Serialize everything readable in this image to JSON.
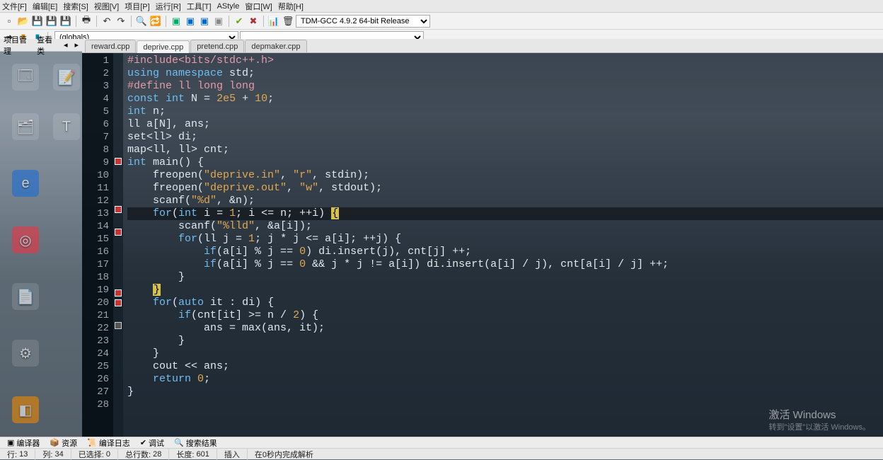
{
  "menu": {
    "items": [
      "文件[F]",
      "编辑[E]",
      "搜索[S]",
      "视图[V]",
      "项目[P]",
      "运行[R]",
      "工具[T]",
      "AStyle",
      "窗口[W]",
      "帮助[H]"
    ]
  },
  "toolbar": {
    "compiler": "TDM-GCC 4.9.2 64-bit Release",
    "scope": "(globals)"
  },
  "left": {
    "project": "项目管理",
    "view": "查看类"
  },
  "tabs": [
    {
      "label": "reward.cpp",
      "active": false
    },
    {
      "label": "deprive.cpp",
      "active": true
    },
    {
      "label": "pretend.cpp",
      "active": false
    },
    {
      "label": "depmaker.cpp",
      "active": false
    }
  ],
  "code": {
    "lines": [
      {
        "n": 1,
        "fold": "",
        "html": "<span class='pp'>#include</span><span class='pp'>&lt;bits/stdc++.h&gt;</span>"
      },
      {
        "n": 2,
        "fold": "",
        "html": "<span class='kw'>using</span> <span class='kw'>namespace</span> std;"
      },
      {
        "n": 3,
        "fold": "",
        "html": "<span class='pp'>#define ll long long</span>"
      },
      {
        "n": 4,
        "fold": "",
        "html": "<span class='kw'>const</span> <span class='type'>int</span> N = <span class='num'>2e5</span> + <span class='num'>10</span>;"
      },
      {
        "n": 5,
        "fold": "",
        "html": "<span class='type'>int</span> n;"
      },
      {
        "n": 6,
        "fold": "",
        "html": "ll a[N], ans;"
      },
      {
        "n": 7,
        "fold": "",
        "html": "set&lt;ll&gt; di;"
      },
      {
        "n": 8,
        "fold": "",
        "html": "map&lt;ll, ll&gt; cnt;"
      },
      {
        "n": 9,
        "fold": "minus",
        "html": "<span class='type'>int</span> <span class='fn'>main</span>() {"
      },
      {
        "n": 10,
        "fold": "",
        "html": "    freopen(<span class='str'>\"deprive.in\"</span>, <span class='str'>\"r\"</span>, stdin);"
      },
      {
        "n": 11,
        "fold": "",
        "html": "    freopen(<span class='str'>\"deprive.out\"</span>, <span class='str'>\"w\"</span>, stdout);"
      },
      {
        "n": 12,
        "fold": "",
        "html": "    scanf(<span class='str'>\"%d\"</span>, &amp;n);"
      },
      {
        "n": 13,
        "fold": "minus",
        "cur": true,
        "html": "    <span class='kw'>for</span>(<span class='type'>int</span> i = <span class='num'>1</span>; i &lt;= n; ++i) <span class='brace-hl'>{</span>"
      },
      {
        "n": 14,
        "fold": "",
        "html": "        scanf(<span class='str'>\"%lld\"</span>, &amp;a[i]);"
      },
      {
        "n": 15,
        "fold": "minus",
        "html": "        <span class='kw'>for</span>(ll j = <span class='num'>1</span>; j * j &lt;= a[i]; ++j) {"
      },
      {
        "n": 16,
        "fold": "",
        "html": "            <span class='kw'>if</span>(a[i] % j == <span class='num'>0</span>) di.insert(j), cnt[j] ++;"
      },
      {
        "n": 17,
        "fold": "",
        "html": "            <span class='kw'>if</span>(a[i] % j == <span class='num'>0</span> &amp;&amp; j * j != a[i]) di.insert(a[i] / j), cnt[a[i] / j] ++;"
      },
      {
        "n": 18,
        "fold": "",
        "html": "        }"
      },
      {
        "n": 19,
        "fold": "",
        "html": "    <span class='brace-hl'>}</span>"
      },
      {
        "n": 20,
        "fold": "minus",
        "html": "    <span class='kw'>for</span>(<span class='kw'>auto</span> it : di) {"
      },
      {
        "n": 21,
        "fold": "minus",
        "html": "        <span class='kw'>if</span>(cnt[it] &gt;= n / <span class='num'>2</span>) {"
      },
      {
        "n": 22,
        "fold": "",
        "html": "            ans = max(ans, it);"
      },
      {
        "n": 23,
        "fold": "box",
        "html": "        }"
      },
      {
        "n": 24,
        "fold": "",
        "html": "    }"
      },
      {
        "n": 25,
        "fold": "",
        "html": "    cout &lt;&lt; ans;"
      },
      {
        "n": 26,
        "fold": "",
        "html": "    <span class='kw'>return</span> <span class='num'>0</span>;"
      },
      {
        "n": 27,
        "fold": "",
        "html": "}"
      },
      {
        "n": 28,
        "fold": "",
        "html": ""
      }
    ]
  },
  "bottom": {
    "tabs": [
      "编译器",
      "资源",
      "编译日志",
      "调试",
      "搜索结果"
    ]
  },
  "status": {
    "line_lbl": "行:",
    "line": "13",
    "col_lbl": "列:",
    "col": "34",
    "sel_lbl": "已选择:",
    "sel": "0",
    "total_lbl": "总行数:",
    "total": "28",
    "len_lbl": "长度:",
    "len": "601",
    "mode": "插入",
    "parse": "在0秒内完成解析"
  },
  "watermark": {
    "title": "激活 Windows",
    "sub": "转到\"设置\"以激活 Windows。"
  }
}
